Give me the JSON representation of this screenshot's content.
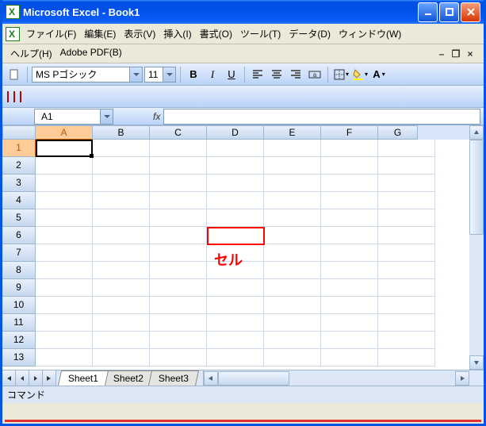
{
  "titlebar": {
    "title": "Microsoft Excel - Book1"
  },
  "menu": {
    "file": "ファイル(F)",
    "edit": "編集(E)",
    "view": "表示(V)",
    "insert": "挿入(I)",
    "format": "書式(O)",
    "tools": "ツール(T)",
    "data": "データ(D)",
    "window": "ウィンドウ(W)",
    "help": "ヘルプ(H)",
    "adobe": "Adobe PDF(B)"
  },
  "toolbar": {
    "font_name": "MS Pゴシック",
    "font_size": "11",
    "bold": "B",
    "italic": "I",
    "underline": "U"
  },
  "formula": {
    "namebox": "A1",
    "fx": "fx"
  },
  "columns": [
    "A",
    "B",
    "C",
    "D",
    "E",
    "F",
    "G"
  ],
  "rows": [
    "1",
    "2",
    "3",
    "4",
    "5",
    "6",
    "7",
    "8",
    "9",
    "10",
    "11",
    "12",
    "13"
  ],
  "annotation": {
    "label": "セル"
  },
  "sheets": {
    "s1": "Sheet1",
    "s2": "Sheet2",
    "s3": "Sheet3"
  },
  "status": {
    "text": "コマンド"
  }
}
